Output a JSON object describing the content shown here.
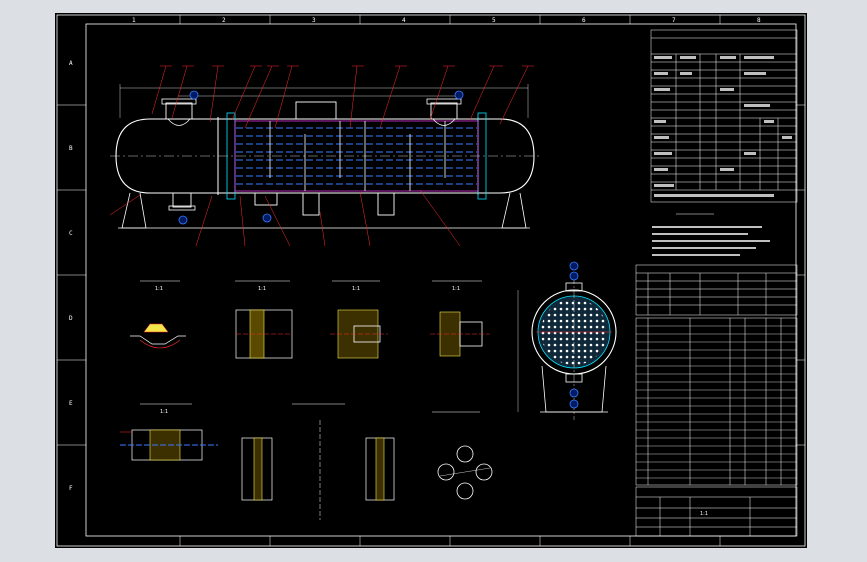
{
  "sheet": {
    "frame_color": "#ffffff",
    "background": "#000000",
    "viewport_bg": "#dcdfe3",
    "accent_colors": {
      "shell": "#ffffff",
      "tube": "#3a7bff",
      "leader": "#ff2b2b",
      "hatch": "#f2e64a",
      "flange": "#00e5ff",
      "highlight": "#ff3cff"
    },
    "zone_numbers_top": [
      "1",
      "2",
      "3",
      "4",
      "5",
      "6",
      "7",
      "8"
    ],
    "zone_letters_left": [
      "A",
      "B",
      "C",
      "D",
      "E",
      "F"
    ]
  },
  "detail_views": {
    "view_a_scale": "1:1",
    "view_b_scale": "1:1",
    "view_c_scale": "1:1",
    "view_d_scale": "1:1",
    "view_e_scale": "1:1"
  },
  "title_block": {
    "sheet_label": "1:1"
  },
  "icons": [
    "section-cut-icon",
    "nozzle-marker-icon",
    "balloon-icon"
  ]
}
